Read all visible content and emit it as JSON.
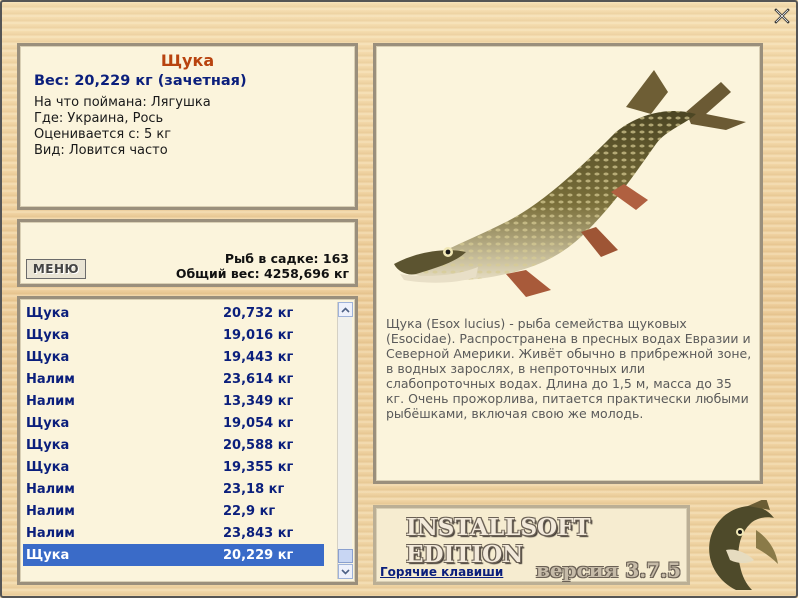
{
  "info": {
    "fish_name": "Щука",
    "weight_line": "Вес: 20,229 кг (зачетная)",
    "details": [
      "На что поймана: Лягушка",
      "Где: Украина, Рось",
      "Оценивается с: 5 кг",
      "Вид: Ловится часто"
    ]
  },
  "keeper": {
    "menu_label": "МЕНЮ",
    "fish_count": "Рыб в садке: 163",
    "total_weight": "Общий вес: 4258,696 кг"
  },
  "catches": [
    {
      "name": "Щука",
      "weight": "20,732 кг"
    },
    {
      "name": "Щука",
      "weight": "19,016 кг"
    },
    {
      "name": "Щука",
      "weight": "19,443 кг"
    },
    {
      "name": "Налим",
      "weight": "23,614 кг"
    },
    {
      "name": "Налим",
      "weight": "13,349 кг"
    },
    {
      "name": "Щука",
      "weight": "19,054 кг"
    },
    {
      "name": "Щука",
      "weight": "20,588 кг"
    },
    {
      "name": "Щука",
      "weight": "19,355 кг"
    },
    {
      "name": "Налим",
      "weight": "23,18 кг"
    },
    {
      "name": "Налим",
      "weight": "22,9 кг"
    },
    {
      "name": "Налим",
      "weight": "23,843 кг"
    },
    {
      "name": "Щука",
      "weight": "20,229 кг"
    }
  ],
  "selected_catch_index": 11,
  "description": "Щука (Esox lucius) - рыба семейства щуковых (Esocidae). Распространена в пресных водах Евразии и Северной Америки. Живёт обычно в прибрежной зоне, в водных зарослях, в непроточных или слабопроточных водах. Длина до 1,5 м, масса до 35 кг. Очень прожорлива, питается практически любыми рыбёшками, включая свою же молодь.",
  "footer": {
    "brand": "INSTALLSOFT EDITION",
    "hotkeys_link": "Горячие клавиши",
    "version": "версия 3.7.5"
  },
  "icons": {
    "close": "close-icon",
    "scroll_up": "chevron-up-icon",
    "scroll_down": "chevron-down-icon",
    "fish_image": "pike-image",
    "logo": "pike-logo-icon"
  },
  "colors": {
    "background": "#e8c990",
    "panel": "#fbf4dc",
    "fish_title": "#b8430f",
    "text_blue": "#0b1f7c",
    "selection": "#3a6bc8"
  }
}
